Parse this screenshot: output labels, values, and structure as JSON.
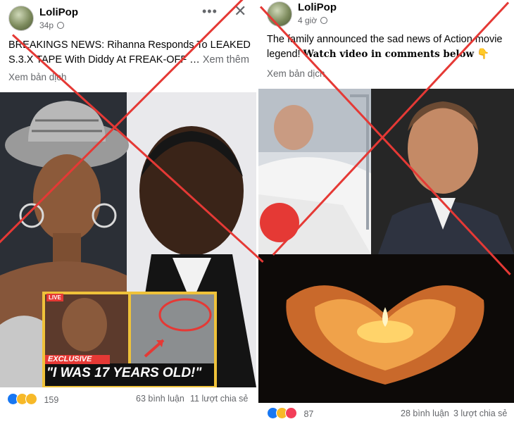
{
  "post1": {
    "author": "LoliPop",
    "time": "34p",
    "text": "BREAKINGS NEWS: Rihanna Responds To LEAKED S.3.X TAPE With Diddy At FREAK-OFF …",
    "see_more": "Xem thêm",
    "translate": "Xem bản dịch",
    "inset_tag": "LIVE",
    "inset_banner_top": "EXCLUSIVE",
    "inset_banner": "\"I WAS 17 YEARS OLD!\"",
    "reaction_count": "159",
    "comments": "63 bình luận",
    "shares": "11 lượt chia sẻ",
    "menu_icon": "more-icon",
    "close_icon": "close-icon"
  },
  "post2": {
    "author": "LoliPop",
    "time": "4 giờ",
    "text_plain": "The family announced the sad news of Action movie legend!",
    "text_bold": "Watch video in comments below",
    "text_emoji": "👇",
    "translate": "Xem bản dịch",
    "reaction_count": "87",
    "comments": "28 bình luận",
    "shares": "3 lượt chia sẻ"
  },
  "colors": {
    "cross": "#e53935",
    "muted": "#65676b",
    "like": "#1877f2"
  }
}
